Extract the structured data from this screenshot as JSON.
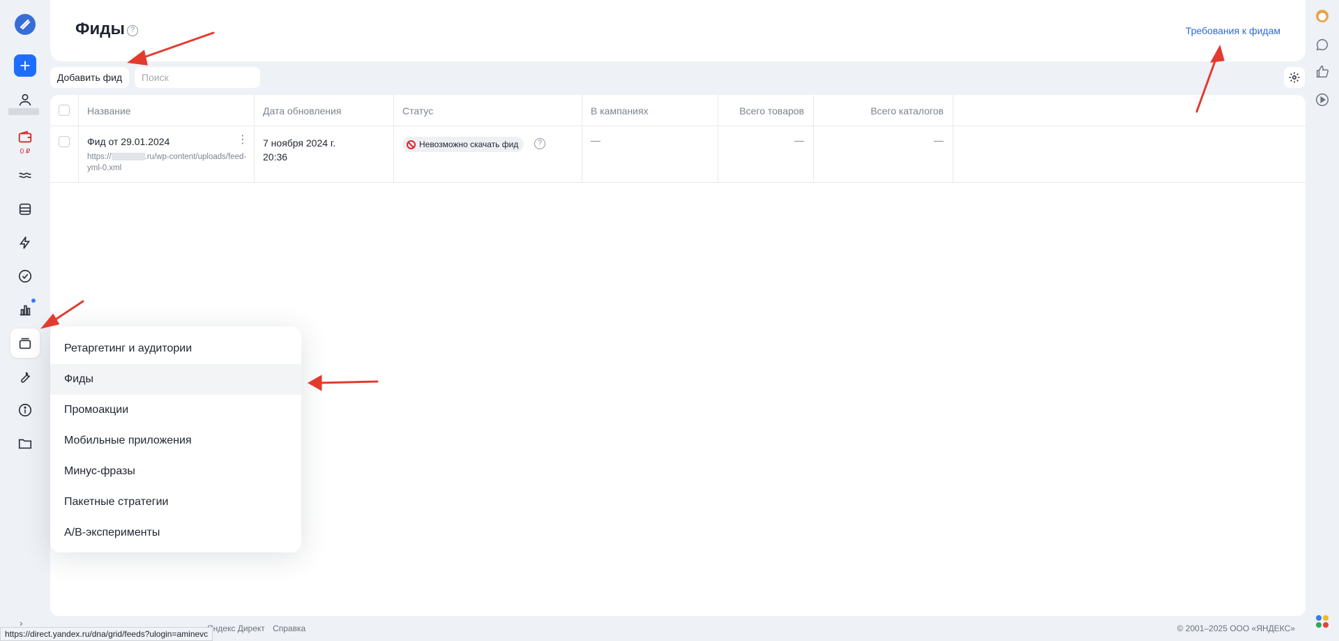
{
  "header": {
    "title": "Фиды",
    "requirements_link": "Требования к фидам"
  },
  "toolbar": {
    "add_feed_label": "Добавить фид",
    "search_placeholder": "Поиск"
  },
  "table": {
    "columns": [
      "Название",
      "Дата обновления",
      "Статус",
      "В кампаниях",
      "Всего товаров",
      "Всего каталогов"
    ],
    "rows": [
      {
        "name": "Фид от 29.01.2024",
        "url_prefix": "https://",
        "url_suffix": ".ru/wp-content/uploads/feed-yml-0.xml",
        "updated_date": "7 ноября 2024 г.",
        "updated_time": "20:36",
        "status": "Невозможно скачать фид",
        "in_campaigns": "—",
        "total_products": "—",
        "total_catalogs": "—"
      }
    ]
  },
  "rail": {
    "balance": "0 ₽"
  },
  "menu": {
    "items": [
      "Ретаргетинг и аудитории",
      "Фиды",
      "Промоакции",
      "Мобильные приложения",
      "Минус-фразы",
      "Пакетные стратегии",
      "A/B-эксперименты"
    ],
    "hovered_index": 1
  },
  "footer": {
    "direct_link": "Яндекс Директ",
    "help_link": "Справка",
    "copyright": "© 2001–2025 ООО «ЯНДЕКС»",
    "status_url": "https://direct.yandex.ru/dna/grid/feeds?ulogin=aminevc"
  },
  "colors": {
    "accent": "#1f6dff",
    "link": "#2d6ad6",
    "error": "#e0242b",
    "annotation_arrow": "#e23b2e",
    "background": "#eef1f5"
  }
}
